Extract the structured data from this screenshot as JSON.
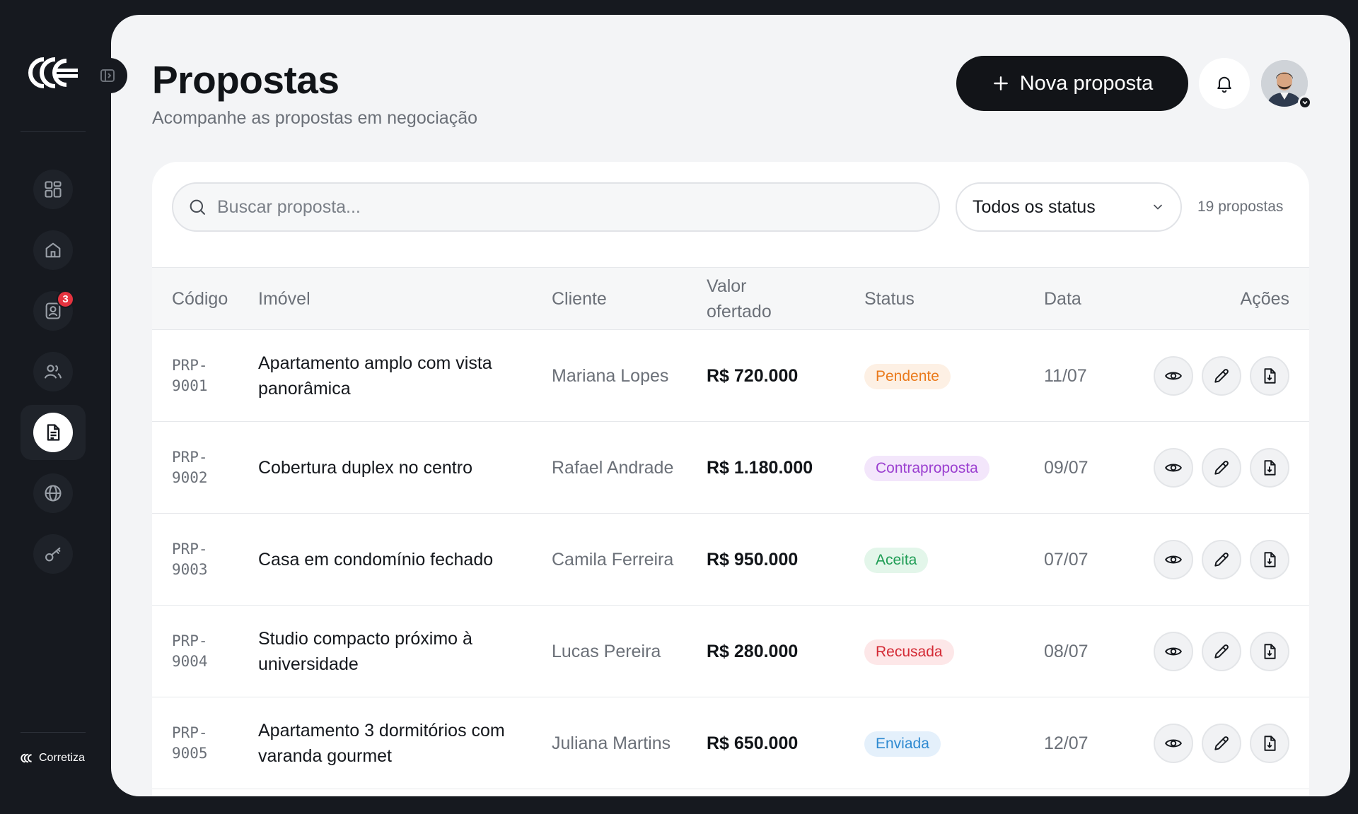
{
  "brand": {
    "name": "Corretiza"
  },
  "sidebar": {
    "items": [
      {
        "name": "dashboard",
        "badge": ""
      },
      {
        "name": "home",
        "badge": ""
      },
      {
        "name": "contacts",
        "badge": "3"
      },
      {
        "name": "users",
        "badge": ""
      },
      {
        "name": "proposals",
        "badge": "",
        "active": true
      },
      {
        "name": "globe",
        "badge": ""
      },
      {
        "name": "key",
        "badge": ""
      }
    ]
  },
  "header": {
    "title": "Propostas",
    "subtitle": "Acompanhe as propostas em negociação",
    "new_button_label": "Nova proposta"
  },
  "toolbar": {
    "search_placeholder": "Buscar proposta...",
    "status_filter": "Todos os status",
    "count": "19 propostas"
  },
  "table": {
    "headers": {
      "code": "Código",
      "property": "Imóvel",
      "client": "Cliente",
      "value": "Valor ofertado",
      "status": "Status",
      "date": "Data",
      "actions": "Ações"
    },
    "rows": [
      {
        "code": "PRP-9001",
        "property": "Apartamento amplo com vista panorâmica",
        "client": "Mariana Lopes",
        "value": "R$ 720.000",
        "status": "Pendente",
        "date": "11/07"
      },
      {
        "code": "PRP-9002",
        "property": "Cobertura duplex no centro",
        "client": "Rafael Andrade",
        "value": "R$ 1.180.000",
        "status": "Contraproposta",
        "date": "09/07"
      },
      {
        "code": "PRP-9003",
        "property": "Casa em condomínio fechado",
        "client": "Camila Ferreira",
        "value": "R$ 950.000",
        "status": "Aceita",
        "date": "07/07"
      },
      {
        "code": "PRP-9004",
        "property": "Studio compacto próximo à universidade",
        "client": "Lucas Pereira",
        "value": "R$ 280.000",
        "status": "Recusada",
        "date": "08/07"
      },
      {
        "code": "PRP-9005",
        "property": "Apartamento 3 dormitórios com varanda gourmet",
        "client": "Juliana Martins",
        "value": "R$ 650.000",
        "status": "Enviada",
        "date": "12/07"
      }
    ]
  },
  "status_colors": {
    "Pendente": {
      "bg": "#fdf0e4",
      "fg": "#ea7a1c"
    },
    "Contraproposta": {
      "bg": "#f3e6fb",
      "fg": "#9b3fd0"
    },
    "Aceita": {
      "bg": "#e3f6ea",
      "fg": "#1f9d55"
    },
    "Recusada": {
      "bg": "#fde7e8",
      "fg": "#d42a35"
    },
    "Enviada": {
      "bg": "#e4f0fb",
      "fg": "#2f8ad1"
    }
  },
  "icons": {
    "view": "eye-icon",
    "edit": "pencil-icon",
    "download": "file-download-icon"
  }
}
